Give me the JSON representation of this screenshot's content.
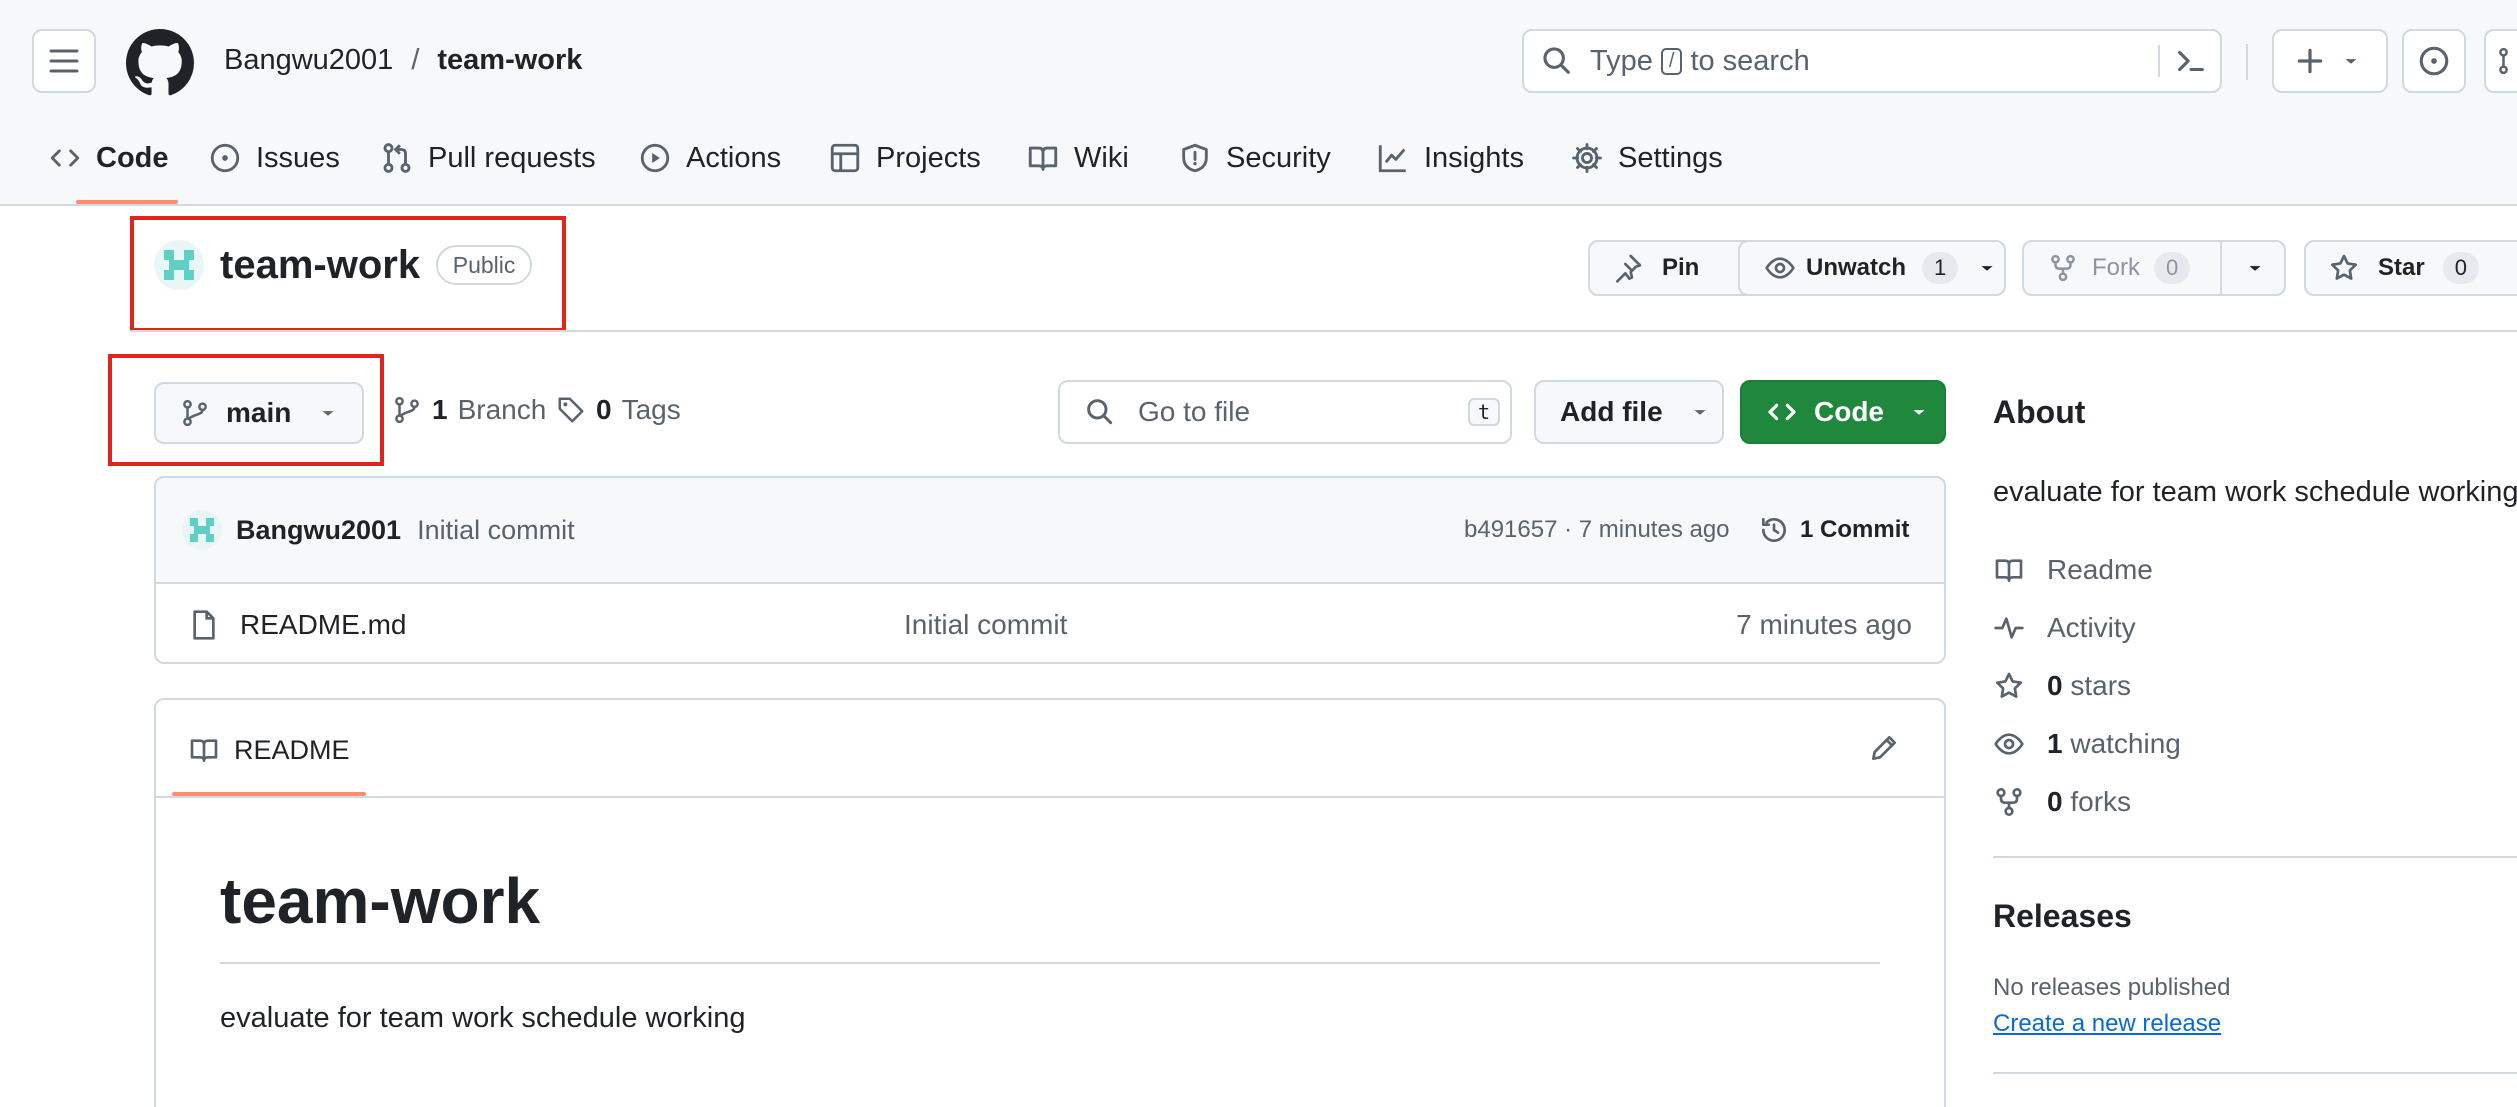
{
  "header": {
    "owner": "Bangwu2001",
    "separator": "/",
    "repo": "team-work",
    "search_pre": "Type",
    "search_key": "/",
    "search_post": "to search"
  },
  "tabs": [
    {
      "label": "Code",
      "icon": "code-icon",
      "selected": true
    },
    {
      "label": "Issues",
      "icon": "issue-icon"
    },
    {
      "label": "Pull requests",
      "icon": "pull-request-icon"
    },
    {
      "label": "Actions",
      "icon": "play-icon"
    },
    {
      "label": "Projects",
      "icon": "table-icon"
    },
    {
      "label": "Wiki",
      "icon": "book-icon"
    },
    {
      "label": "Security",
      "icon": "shield-icon"
    },
    {
      "label": "Insights",
      "icon": "graph-icon"
    },
    {
      "label": "Settings",
      "icon": "gear-icon"
    }
  ],
  "repo_header": {
    "name": "team-work",
    "visibility": "Public",
    "pin_label": "Pin",
    "unwatch_label": "Unwatch",
    "watch_count": "1",
    "fork_label": "Fork",
    "fork_count": "0",
    "star_label": "Star",
    "star_count": "0"
  },
  "toolbar": {
    "branch": "main",
    "branch_count": "1",
    "branch_label": "Branch",
    "tag_count": "0",
    "tag_label": "Tags",
    "goto_placeholder": "Go to file",
    "goto_key": "t",
    "add_file_label": "Add file",
    "code_label": "Code"
  },
  "commit": {
    "author": "Bangwu2001",
    "message": "Initial commit",
    "meta": "b491657 · 7 minutes ago",
    "count_label": "1 Commit"
  },
  "files": [
    {
      "name": "README.md",
      "message": "Initial commit",
      "time": "7 minutes ago",
      "icon": "file-icon"
    }
  ],
  "readme": {
    "tab_label": "README",
    "title": "team-work",
    "body": "evaluate for team work schedule working"
  },
  "about": {
    "heading": "About",
    "description": "evaluate for team work schedule working",
    "readme_label": "Readme",
    "activity_label": "Activity",
    "stars_count": "0",
    "stars_label": "stars",
    "watching_count": "1",
    "watching_label": "watching",
    "forks_count": "0",
    "forks_label": "forks"
  },
  "releases": {
    "heading": "Releases",
    "none_text": "No releases published",
    "create_link": "Create a new release"
  },
  "colors": {
    "accent_underline": "#fd8c73",
    "primary_button": "#1f883d",
    "link": "#0969da",
    "annotation_box": "#e5231d"
  }
}
